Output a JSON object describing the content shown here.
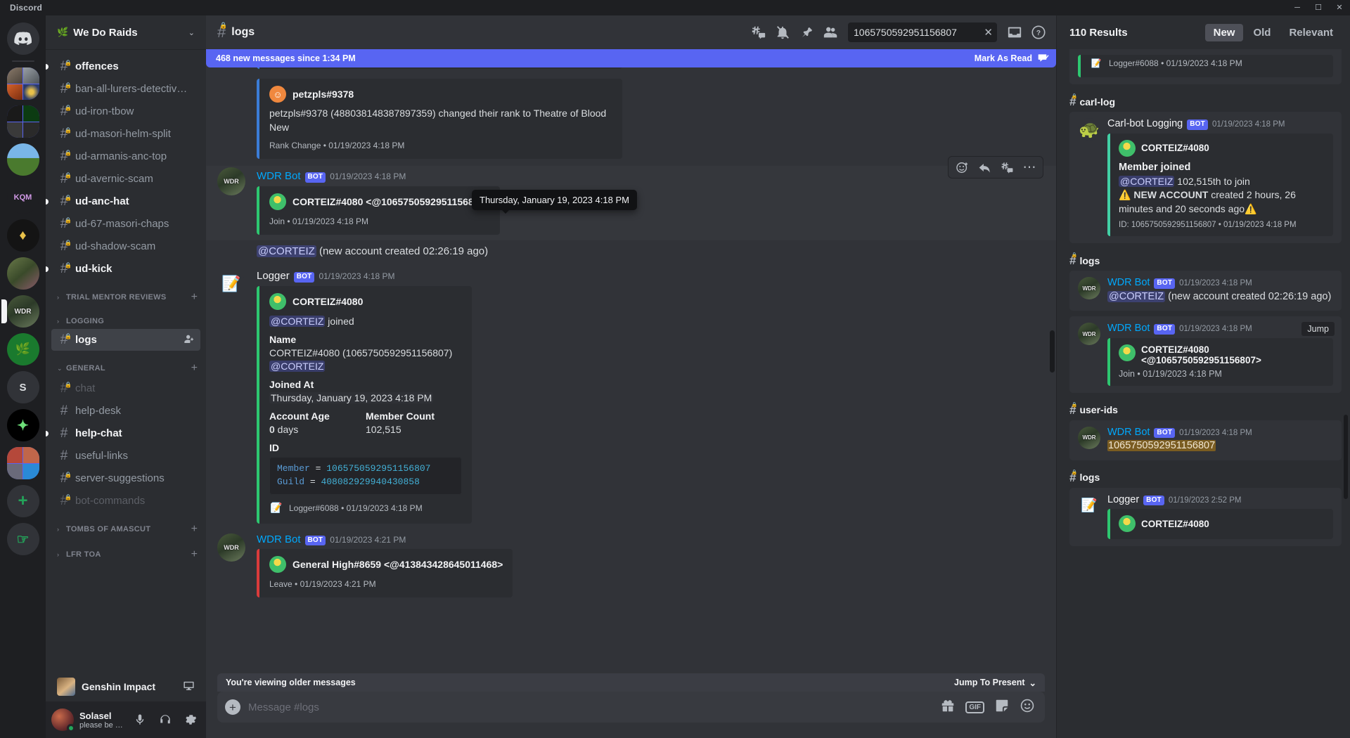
{
  "titlebar": {
    "app_name": "Discord",
    "minimize": "─",
    "maximize": "☐",
    "close": "✕"
  },
  "guild_header": {
    "emoji": "🌿",
    "name": "We Do Raids",
    "chevron": "⌄"
  },
  "sidebar": {
    "channels": [
      {
        "name": "offences",
        "state": "unread",
        "locked": true
      },
      {
        "name": "ban-all-lurers-detectiv…",
        "state": "normal",
        "locked": true
      },
      {
        "name": "ud-iron-tbow",
        "state": "normal",
        "locked": true
      },
      {
        "name": "ud-masori-helm-split",
        "state": "normal",
        "locked": true
      },
      {
        "name": "ud-armanis-anc-top",
        "state": "normal",
        "locked": true
      },
      {
        "name": "ud-avernic-scam",
        "state": "normal",
        "locked": true
      },
      {
        "name": "ud-anc-hat",
        "state": "unread",
        "locked": true
      },
      {
        "name": "ud-67-masori-chaps",
        "state": "normal",
        "locked": true
      },
      {
        "name": "ud-shadow-scam",
        "state": "normal",
        "locked": true
      },
      {
        "name": "ud-kick",
        "state": "unread",
        "locked": true
      }
    ],
    "categories": [
      {
        "name": "TRIAL MENTOR REVIEWS",
        "collapsed": true,
        "arrow": "›",
        "plus": "+"
      },
      {
        "name": "LOGGING",
        "collapsed": true,
        "arrow": "›",
        "plus": ""
      },
      {
        "name": "GENERAL",
        "collapsed": false,
        "arrow": "⌄",
        "plus": "+"
      },
      {
        "name": "TOMBS OF AMASCUT",
        "collapsed": true,
        "arrow": "›",
        "plus": "+"
      },
      {
        "name": "LFR TOA",
        "collapsed": true,
        "arrow": "›",
        "plus": "+"
      }
    ],
    "logging_channels": [
      {
        "name": "logs",
        "state": "active",
        "locked": true,
        "invite_icon": "👤⁺"
      }
    ],
    "general_channels": [
      {
        "name": "chat",
        "state": "muted",
        "locked": true
      },
      {
        "name": "help-desk",
        "state": "normal",
        "locked": false
      },
      {
        "name": "help-chat",
        "state": "unread",
        "locked": false
      },
      {
        "name": "useful-links",
        "state": "normal",
        "locked": false
      },
      {
        "name": "server-suggestions",
        "state": "normal",
        "locked": true
      },
      {
        "name": "bot-commands",
        "state": "muted",
        "locked": true
      }
    ],
    "activity": {
      "title": "Genshin Impact",
      "launch_icon": "🖥"
    },
    "user": {
      "name": "Solasel",
      "status_text": "please be kin…",
      "mute_icon": "🎤",
      "deafen_icon": "🎧",
      "settings_icon": "⚙"
    }
  },
  "chat_header": {
    "channel": "logs",
    "icons": {
      "threads": "threads-icon",
      "notifications_off": "bell-off-icon",
      "pinned": "pin-icon",
      "members": "members-icon",
      "inbox": "inbox-icon",
      "help": "help-icon"
    },
    "search_value": "1065750592951156807",
    "search_clear": "✕",
    "help_label": "?"
  },
  "new_messages_bar": {
    "text": "468 new messages since 1:34 PM",
    "mark_as_read": "Mark As Read"
  },
  "tooltip": {
    "text": "Thursday, January 19, 2023 4:18 PM"
  },
  "hover_actions": {
    "add_reaction": "add-reaction-icon",
    "reply": "reply-icon",
    "thread": "thread-icon",
    "more": "⋯"
  },
  "messages": [
    {
      "id": "petzpls",
      "partial_top_text": "Rank Change • 01/19/2023 4:18 PM",
      "author": "petzpls#9378",
      "embed_author": "petzpls#9378",
      "embed_desc": "petzpls#9378 (488038148387897359) changed their rank to Theatre of Blood New",
      "embed_footer": "Rank Change • 01/19/2023 4:18 PM"
    },
    {
      "id": "wdr-join",
      "author": "WDR Bot",
      "bot_tag": "BOT",
      "timestamp": "01/19/2023 4:18 PM",
      "embed_author": "CORTEIZ#4080  <@1065750592951156807>",
      "embed_footer": "Join • 01/19/2023 4:18 PM"
    },
    {
      "id": "wdr-newaccount",
      "mention": "@CORTEIZ",
      "text": " (new account created 02:26:19 ago)"
    },
    {
      "id": "logger-join",
      "author": "Logger",
      "bot_tag": "BOT",
      "timestamp": "01/19/2023 4:18 PM",
      "embed_author": "CORTEIZ#4080",
      "embed_desc_mention": "@CORTEIZ",
      "embed_desc_rest": " joined",
      "field_name_label": "Name",
      "field_name_value": "CORTEIZ#4080 (1065750592951156807) ",
      "field_name_mention": "@CORTEIZ",
      "field_joined_label": "Joined At",
      "field_joined_value": "Thursday, January 19, 2023 4:18 PM",
      "field_age_label": "Account Age",
      "field_age_value_bold": "0",
      "field_age_value_rest": " days",
      "field_count_label": "Member Count",
      "field_count_value": "102,515",
      "field_id_label": "ID",
      "code_member_key": "Member",
      "code_eq": "=",
      "code_member_val": "1065750592951156807",
      "code_guild_key": "Guild",
      "code_guild_val": "408082929940430858",
      "embed_footer": "Logger#6088 • 01/19/2023 4:18 PM"
    },
    {
      "id": "wdr-leave",
      "author": "WDR Bot",
      "bot_tag": "BOT",
      "timestamp": "01/19/2023 4:21 PM",
      "embed_author": "General High#8659  <@413843428645011468>",
      "embed_footer": "Leave • 01/19/2023 4:21 PM"
    }
  ],
  "jump_bar": {
    "viewing_older": "You're viewing older messages",
    "jump_to_present": "Jump To Present",
    "chevron": "⌄"
  },
  "composer": {
    "placeholder": "Message #logs",
    "plus": "+",
    "gift_icon": "🎁",
    "gif_label": "GIF",
    "sticker_icon": "sticker-icon",
    "emoji_icon": "🙂"
  },
  "results": {
    "count_label": "110 Results",
    "tabs": [
      {
        "label": "New",
        "active": true
      },
      {
        "label": "Old",
        "active": false
      },
      {
        "label": "Relevant",
        "active": false
      }
    ],
    "partial_top": {
      "footer": "Logger#6088 • 01/19/2023 4:18 PM"
    },
    "groups": [
      {
        "channel": "carl-log",
        "items": [
          {
            "author": "Carl-bot Logging",
            "bot_tag": "BOT",
            "timestamp": "01/19/2023 4:18 PM",
            "embed_author": "CORTEIZ#4080",
            "embed_title": "Member joined",
            "embed_mention": "@CORTEIZ",
            "embed_desc": " 102,515th to join",
            "embed_warn_prefix": "⚠️",
            "embed_warn_bold": "NEW ACCOUNT",
            "embed_warn_rest": " created 2 hours, 26 minutes and 20 seconds ago",
            "embed_warn_suffix": "⚠️",
            "embed_footer": "ID: 1065750592951156807 • 01/19/2023 4:18 PM"
          }
        ]
      },
      {
        "channel": "logs",
        "items": [
          {
            "author": "WDR Bot",
            "bot_tag": "BOT",
            "timestamp": "01/19/2023 4:18 PM",
            "mention": "@CORTEIZ",
            "text": " (new account created 02:26:19 ago)"
          },
          {
            "author": "WDR Bot",
            "bot_tag": "BOT",
            "timestamp": "01/19/2023 4:18 PM",
            "jump_label": "Jump",
            "embed_author": "CORTEIZ#4080",
            "embed_author_2": "<@1065750592951156807>",
            "embed_footer": "Join • 01/19/2023 4:18 PM"
          }
        ]
      },
      {
        "channel": "user-ids",
        "items": [
          {
            "author": "WDR Bot",
            "bot_tag": "BOT",
            "timestamp": "01/19/2023 4:18 PM",
            "highlight": "1065750592951156807"
          }
        ]
      },
      {
        "channel": "logs",
        "items": [
          {
            "author": "Logger",
            "bot_tag": "BOT",
            "timestamp": "01/19/2023 2:52 PM",
            "embed_author": "CORTEIZ#4080"
          }
        ]
      }
    ]
  },
  "colors": {
    "blurple": "#5865f2",
    "green_embed": "#2dc770",
    "teal_embed": "#42d0a5",
    "highlight": "#7a5c21",
    "bot_blue": "#00a8fc"
  }
}
